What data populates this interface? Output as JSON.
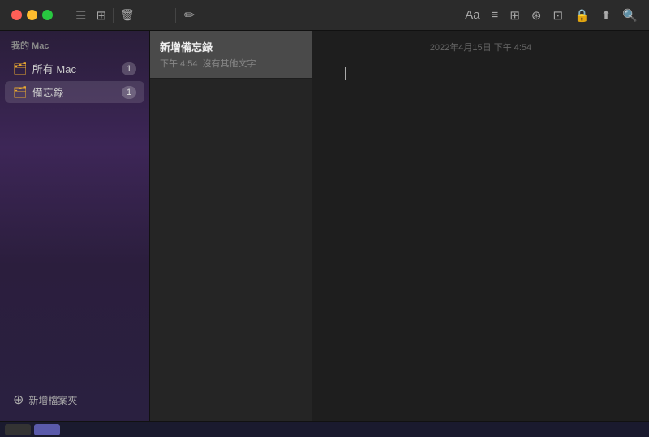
{
  "titlebar": {
    "traffic_close": "close",
    "traffic_minimize": "minimize",
    "traffic_maximize": "maximize"
  },
  "toolbar_right": {
    "icons": [
      "Aa",
      "≡·",
      "⊞",
      "⊛",
      "⊡",
      "🔒",
      "⬆",
      "🔍"
    ]
  },
  "sidebar": {
    "section_label": "我的 Mac",
    "items": [
      {
        "label": "所有 Mac",
        "badge": "1"
      },
      {
        "label": "備忘錄",
        "badge": "1"
      }
    ],
    "new_folder_label": "新增檔案夾"
  },
  "note_list": {
    "toolbar_icons": [
      "☰",
      "⊞"
    ],
    "trash_icon": "🗑",
    "notes": [
      {
        "title": "新增備忘錄",
        "time": "下午 4:54",
        "preview": "沒有其他文字"
      }
    ]
  },
  "editor": {
    "toolbar_icons": [
      "✏️",
      "Aa",
      "≡·",
      "⊞",
      "⊛",
      "⊡",
      "🔒",
      "⬆",
      "🔍"
    ],
    "date": "2022年4月15日 下午 4:54",
    "content": ""
  }
}
